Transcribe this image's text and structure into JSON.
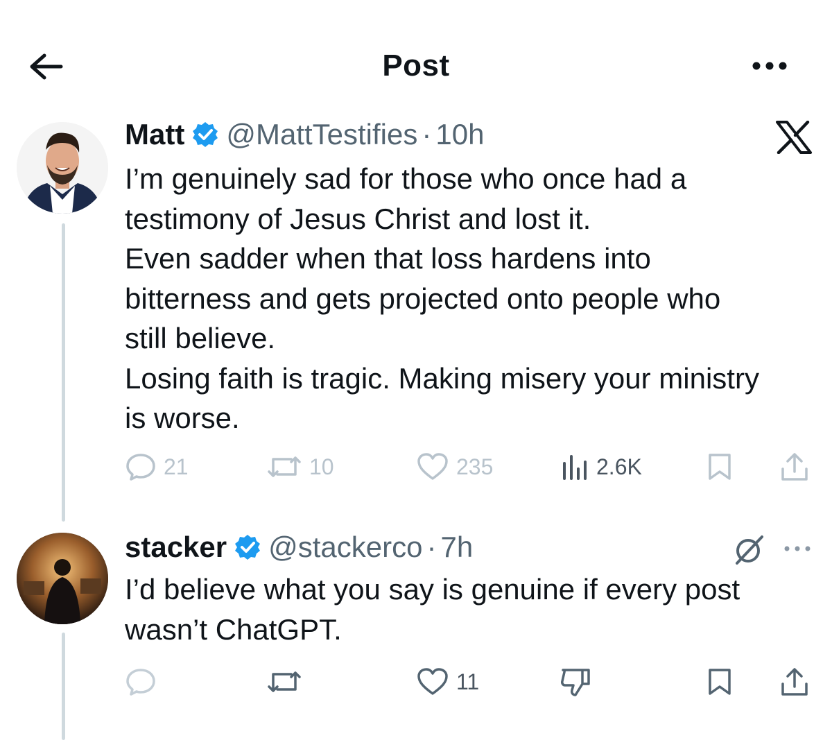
{
  "header": {
    "title": "Post",
    "back_icon": "arrow-left-icon",
    "more_icon": "more-horizontal-icon"
  },
  "posts": [
    {
      "name": "Matt",
      "handle": "@MattTestifies",
      "separator": "·",
      "time": "10h",
      "verified": true,
      "lines": [
        "I’m genuinely sad for those who once had a",
        "testimony of Jesus Christ and lost it.",
        "Even sadder when that loss hardens into",
        "bitterness and gets projected onto people who",
        "still believe.",
        "Losing faith is tragic. Making misery your ministry",
        "is worse."
      ],
      "actions": {
        "replies": "21",
        "reposts": "10",
        "likes": "235",
        "views": "2.6K"
      }
    },
    {
      "name": "stacker",
      "handle": "@stackerco",
      "separator": "·",
      "time": "7h",
      "verified": true,
      "lines": [
        "I’d believe what you say is genuine if every post",
        "wasn’t ChatGPT."
      ],
      "actions": {
        "likes": "11"
      }
    }
  ],
  "colors": {
    "verified_blue": "#1d9bf0",
    "text_primary": "#0f1419",
    "text_secondary": "#536471",
    "faded_icon": "#b8c3cc",
    "thread_line": "#cfd9de"
  }
}
